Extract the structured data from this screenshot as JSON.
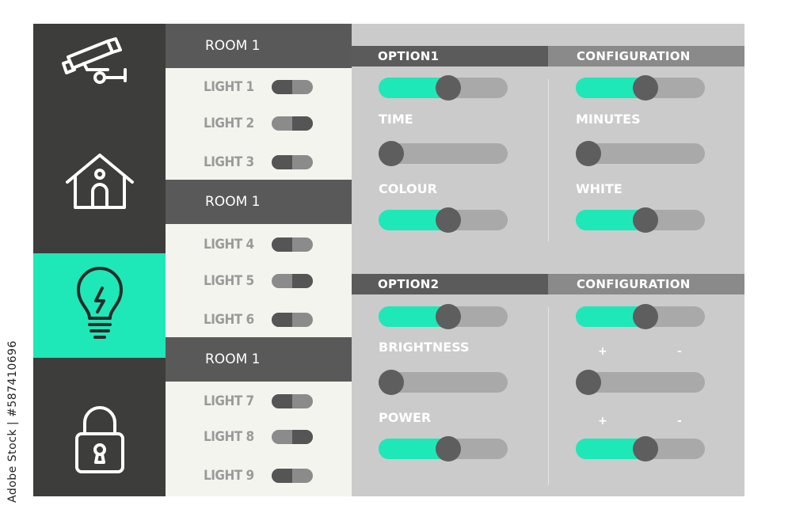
{
  "colors": {
    "accent": "#1ee8b7",
    "nav_bg": "#3d3d3b",
    "room_header": "#595959",
    "panel_bg": "#cbcbcb"
  },
  "nav": {
    "items": [
      {
        "icon": "security-camera-icon",
        "active": false
      },
      {
        "icon": "home-icon",
        "active": false
      },
      {
        "icon": "light-bulb-icon",
        "active": true
      },
      {
        "icon": "padlock-icon",
        "active": false
      }
    ]
  },
  "rooms": [
    {
      "title": "ROOM 1",
      "lights": [
        {
          "label": "LIGHT 1",
          "on": false
        },
        {
          "label": "LIGHT 2",
          "on": true
        },
        {
          "label": "LIGHT 3",
          "on": false
        }
      ]
    },
    {
      "title": "ROOM 1",
      "lights": [
        {
          "label": "LIGHT 4",
          "on": false
        },
        {
          "label": "LIGHT 5",
          "on": true
        },
        {
          "label": "LIGHT 6",
          "on": false
        }
      ]
    },
    {
      "title": "ROOM 1",
      "lights": [
        {
          "label": "LIGHT 7",
          "on": false
        },
        {
          "label": "LIGHT 8",
          "on": true
        },
        {
          "label": "LIGHT 9",
          "on": false
        }
      ]
    }
  ],
  "option1": {
    "header": "OPTION1",
    "config_header": "CONFIGURATION",
    "main_slider": 0.55,
    "config_slider": 0.55,
    "time_label": "TIME",
    "time_slider": 0.0,
    "minutes_label": "MINUTES",
    "minutes_slider": 0.0,
    "colour_label": "COLOUR",
    "colour_slider": 0.55,
    "white_label": "WHITE",
    "white_slider": 0.55
  },
  "option2": {
    "header": "OPTION2",
    "config_header": "CONFIGURATION",
    "main_slider": 0.55,
    "config_slider": 0.55,
    "brightness_label": "BRIGHTNESS",
    "brightness_slider": 0.0,
    "brightness_cfg_slider": 0.0,
    "power_label": "POWER",
    "power_slider": 0.55,
    "power_cfg_slider": 0.55,
    "plus": "+",
    "minus": "-"
  },
  "credit": "Adobe Stock | #587410696"
}
